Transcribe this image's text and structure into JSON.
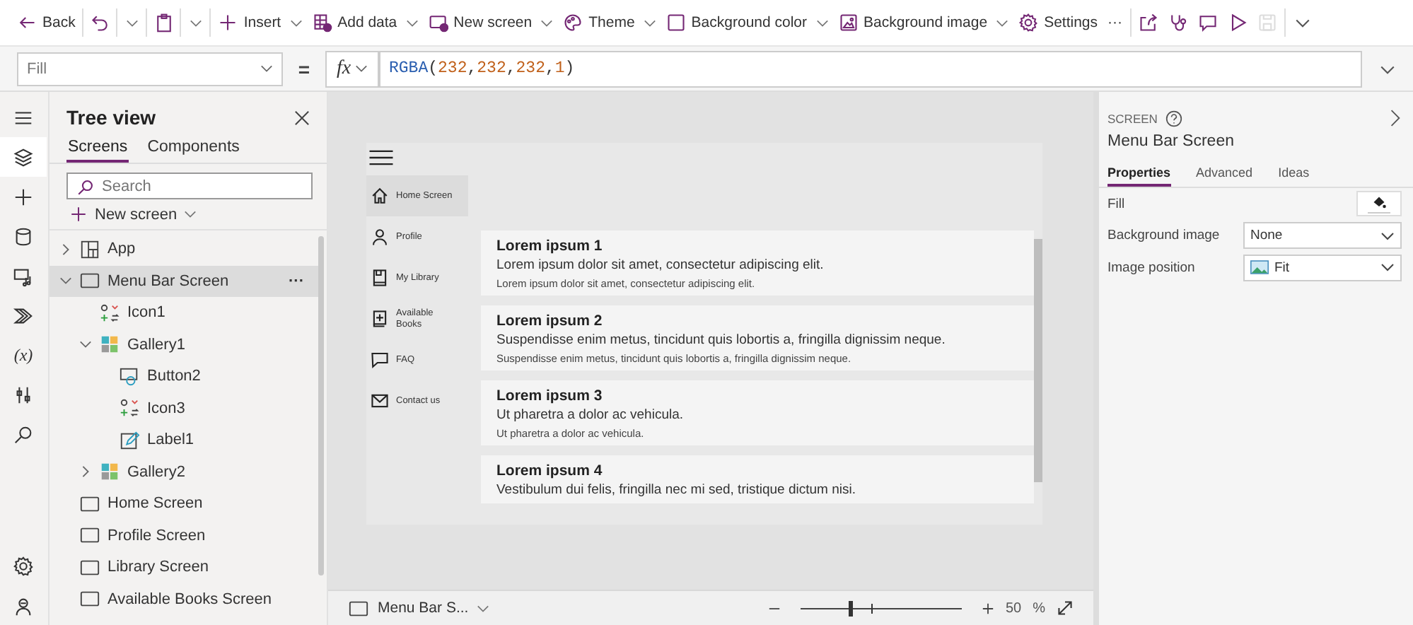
{
  "toolbar": {
    "groups": [
      [
        {
          "kind": "back",
          "label": "Back",
          "menu": false,
          "disabled": false
        }
      ],
      [
        {
          "kind": "undo",
          "menu": true,
          "disabled": false
        }
      ],
      [
        {
          "kind": "paste",
          "menu": true,
          "disabled": false
        }
      ],
      [
        {
          "kind": "insert",
          "label": "Insert",
          "menu": true,
          "disabled": false
        },
        {
          "kind": "add-data",
          "label": "Add data",
          "menu": true,
          "disabled": false
        },
        {
          "kind": "new-screen",
          "label": "New screen",
          "menu": true,
          "disabled": false
        },
        {
          "kind": "theme",
          "label": "Theme",
          "menu": true,
          "disabled": false
        },
        {
          "kind": "bg-color",
          "label": "Background color",
          "menu": true,
          "disabled": false
        },
        {
          "kind": "bg-image",
          "label": "Background image",
          "menu": true,
          "disabled": false
        },
        {
          "kind": "settings",
          "label": "Settings",
          "menu": false,
          "disabled": false
        },
        {
          "kind": "more",
          "label": "···",
          "menu": false,
          "disabled": false
        }
      ],
      [
        {
          "kind": "share",
          "menu": false,
          "disabled": false
        },
        {
          "kind": "health",
          "menu": false,
          "disabled": false
        },
        {
          "kind": "comment",
          "menu": false,
          "disabled": false
        },
        {
          "kind": "play",
          "menu": false,
          "disabled": false
        },
        {
          "kind": "save",
          "menu": false,
          "disabled": true
        }
      ],
      [
        {
          "kind": "chevron",
          "menu": false,
          "disabled": false
        }
      ]
    ]
  },
  "formula_bar": {
    "property": "Fill",
    "equals": "=",
    "fx": "fx",
    "tokens": [
      {
        "text": "RGBA",
        "kind": "function"
      },
      {
        "text": "(",
        "kind": "punct"
      },
      {
        "text": "232",
        "kind": "number"
      },
      {
        "text": ",",
        "kind": "punct"
      },
      {
        "text": "232",
        "kind": "number"
      },
      {
        "text": ",",
        "kind": "punct"
      },
      {
        "text": "232",
        "kind": "number"
      },
      {
        "text": ",",
        "kind": "punct"
      },
      {
        "text": "1",
        "kind": "number"
      },
      {
        "text": ")",
        "kind": "punct"
      }
    ]
  },
  "rail": [
    {
      "kind": "menu",
      "selected": false
    },
    {
      "kind": "tree",
      "selected": true
    },
    {
      "kind": "insert",
      "selected": false
    },
    {
      "kind": "data",
      "selected": false
    },
    {
      "kind": "media",
      "selected": false
    },
    {
      "kind": "automate",
      "selected": false
    },
    {
      "kind": "variables",
      "glyph": "(x)",
      "selected": false
    },
    {
      "kind": "tools",
      "selected": false
    },
    {
      "kind": "search",
      "selected": false
    }
  ],
  "rail_bottom": [
    {
      "kind": "settings",
      "selected": false
    },
    {
      "kind": "agent",
      "selected": false
    }
  ],
  "tree_view": {
    "title": "Tree view",
    "tabs": [
      {
        "label": "Screens",
        "selected": true
      },
      {
        "label": "Components",
        "selected": false
      }
    ],
    "search": {
      "placeholder": "Search"
    },
    "new_screen": "New screen",
    "items": [
      {
        "label": "App",
        "kind": "app",
        "expanded": false,
        "selected": false
      },
      {
        "label": "Menu Bar Screen",
        "kind": "screen",
        "expanded": true,
        "selected": true,
        "more": "···",
        "children": [
          {
            "label": "Icon1",
            "kind": "icon",
            "selected": false
          },
          {
            "label": "Gallery1",
            "kind": "gallery",
            "expanded": true,
            "selected": false,
            "children": [
              {
                "label": "Button2",
                "kind": "button",
                "selected": false
              },
              {
                "label": "Icon3",
                "kind": "icon",
                "selected": false
              },
              {
                "label": "Label1",
                "kind": "label",
                "selected": false
              }
            ]
          },
          {
            "label": "Gallery2",
            "kind": "gallery",
            "expanded": false,
            "selected": false
          }
        ]
      },
      {
        "label": "Home Screen",
        "kind": "screen",
        "selected": false
      },
      {
        "label": "Profile Screen",
        "kind": "screen",
        "selected": false
      },
      {
        "label": "Library Screen",
        "kind": "screen",
        "selected": false
      },
      {
        "label": "Available Books Screen",
        "kind": "screen",
        "selected": false
      }
    ]
  },
  "app_preview": {
    "nav": [
      {
        "label": "Home Screen",
        "kind": "home",
        "selected": true
      },
      {
        "label": "Profile",
        "kind": "person",
        "selected": false
      },
      {
        "label": "My Library",
        "kind": "book",
        "selected": false
      },
      {
        "label": "Available Books",
        "kind": "book-plus",
        "selected": false
      },
      {
        "label": "FAQ",
        "kind": "chat",
        "selected": false
      },
      {
        "label": "Contact us",
        "kind": "mail",
        "selected": false
      }
    ],
    "cards": [
      {
        "title": "Lorem ipsum 1",
        "subtitle": "Lorem ipsum dolor sit amet, consectetur adipiscing elit.",
        "body": "Lorem ipsum dolor sit amet, consectetur adipiscing elit."
      },
      {
        "title": "Lorem ipsum 2",
        "subtitle": "Suspendisse enim metus, tincidunt quis lobortis a, fringilla dignissim neque.",
        "body": "Suspendisse enim metus, tincidunt quis lobortis a, fringilla dignissim neque."
      },
      {
        "title": "Lorem ipsum 3",
        "subtitle": "Ut pharetra a dolor ac vehicula.",
        "body": "Ut pharetra a dolor ac vehicula."
      },
      {
        "title": "Lorem ipsum 4",
        "subtitle": "Vestibulum dui felis, fringilla nec mi sed, tristique dictum nisi."
      }
    ]
  },
  "status_bar": {
    "screen": "Menu Bar S...",
    "zoom": {
      "level": 0.31
    },
    "zoom_value": "50",
    "zoom_unit": "%"
  },
  "properties_panel": {
    "type": "SCREEN",
    "name": "Menu Bar Screen",
    "tabs": [
      {
        "label": "Properties",
        "selected": true
      },
      {
        "label": "Advanced",
        "selected": false
      },
      {
        "label": "Ideas",
        "selected": false
      }
    ],
    "properties": [
      {
        "label": "Fill",
        "kind": "color"
      },
      {
        "label": "Background image",
        "kind": "dropdown",
        "value": "None"
      },
      {
        "label": "Image position",
        "kind": "dropdown",
        "value": "Fit",
        "image_icon": true
      }
    ]
  }
}
